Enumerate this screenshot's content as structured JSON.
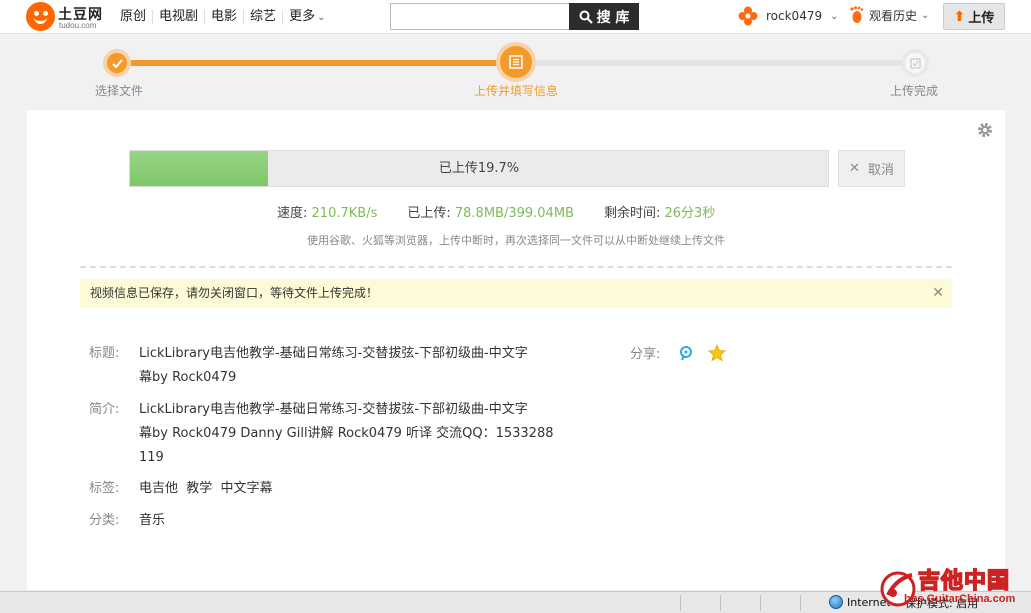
{
  "header": {
    "logo_name": "土豆网",
    "logo_url": "tudou.com",
    "nav": [
      "原创",
      "电视剧",
      "电影",
      "综艺",
      "更多"
    ],
    "search_placeholder": "",
    "search_button": "搜 库",
    "username": "rock0479",
    "history": "观看历史",
    "upload_button": "上传"
  },
  "steps": {
    "items": [
      {
        "label": "选择文件",
        "state": "done"
      },
      {
        "label": "上传并填写信息",
        "state": "active"
      },
      {
        "label": "上传完成",
        "state": "pending"
      }
    ],
    "accent_color": "#f39a2b"
  },
  "upload": {
    "progress_text": "已上传19.7%",
    "progress_percent": 19.7,
    "cancel_label": "取消",
    "speed_label": "速度:",
    "speed_value": "210.7KB/s",
    "uploaded_label": "已上传:",
    "uploaded_value": "78.8MB/399.04MB",
    "remaining_label": "剩余时间:",
    "remaining_value": "26分3秒",
    "hint": "使用谷歌、火狐等浏览器，上传中断时，再次选择同一文件可以从中断处继续上传文件",
    "notice": "视频信息已保存，请勿关闭窗口，等待文件上传完成！"
  },
  "info": {
    "title_label": "标题:",
    "title_value": "LickLibrary电吉他教学-基础日常练习-交替拔弦-下部初级曲-中文字\n幕by Rock0479",
    "desc_label": "简介:",
    "desc_value": "LickLibrary电吉他教学-基础日常练习-交替拔弦-下部初级曲-中文字\n幕by Rock0479 Danny Gill讲解 Rock0479 听译 交流QQ：1533288\n119",
    "tags_label": "标签:",
    "tags_value": "电吉他  教学  中文字幕",
    "category_label": "分类:",
    "category_value": "音乐",
    "share_label": "分享:"
  },
  "statusbar": {
    "zone": "Internet",
    "mode": "保护模式: 启用"
  },
  "watermark": {
    "name": "吉他中国",
    "url": "bbs.GuitarChina.com"
  }
}
